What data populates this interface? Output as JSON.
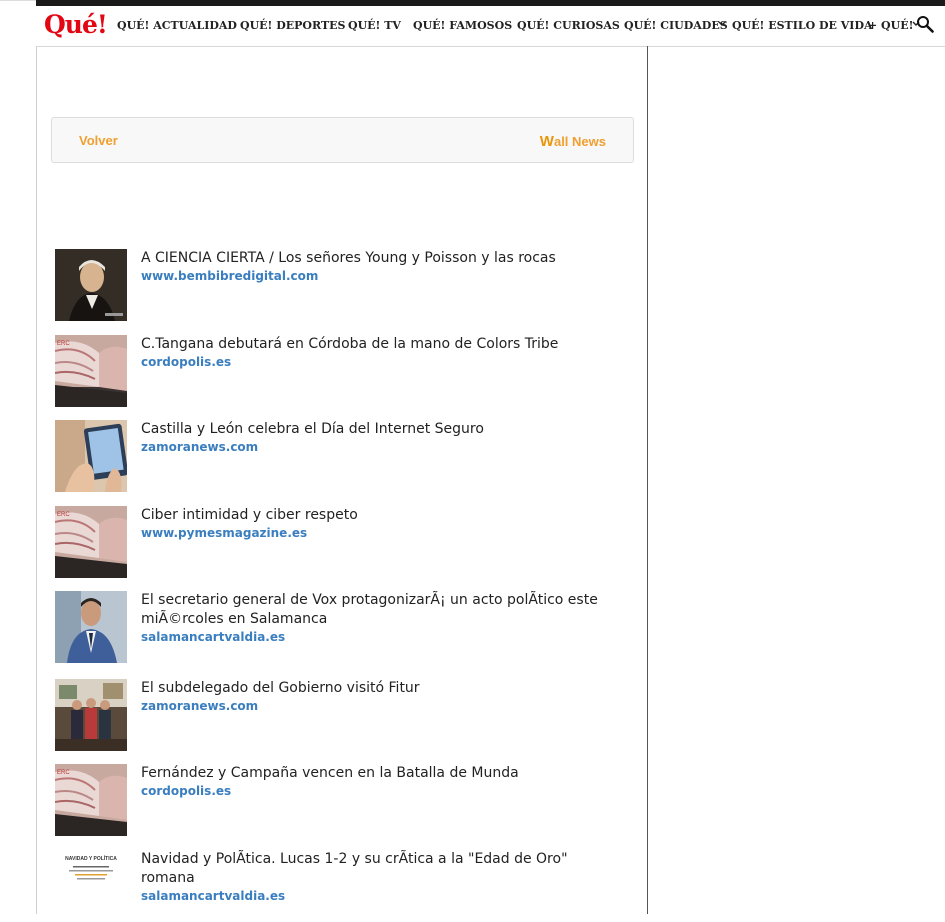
{
  "header": {
    "logo": "Qué!",
    "nav": [
      {
        "label": "QUÉ! ACTUALIDAD"
      },
      {
        "label": "QUÉ! DEPORTES"
      },
      {
        "label": "QUÉ! TV"
      },
      {
        "label": "QUÉ! FAMOSOS"
      },
      {
        "label": "QUÉ! CURIOSAS"
      },
      {
        "label": "QUÉ! CIUDADES"
      },
      {
        "label": "QUÉ! ESTILO DE VIDA"
      },
      {
        "label": "+ QUÉ!"
      }
    ]
  },
  "wall": {
    "back_label": "Volver",
    "brand_w": "W",
    "brand_rest": "all News"
  },
  "articles": [
    {
      "title": "A CIENCIA CIERTA / Los señores Young y Poisson y las rocas",
      "source": "www.bembibredigital.com",
      "thumb": "portrait"
    },
    {
      "title": "C.Tangana debutará en Córdoba de la mano de Colors Tribe",
      "source": "cordopolis.es",
      "thumb": "newspaper"
    },
    {
      "title": "Castilla y León celebra el Día del Internet Seguro",
      "source": "zamoranews.com",
      "thumb": "tablet"
    },
    {
      "title": "Ciber intimidad y ciber respeto",
      "source": "www.pymesmagazine.es",
      "thumb": "newspaper"
    },
    {
      "title": "El secretario general de Vox protagonizarÃ¡ un acto polÃtico este miÃ©rcoles en Salamanca",
      "source": "salamancartvaldia.es",
      "thumb": "man-suit"
    },
    {
      "title": "El subdelegado del Gobierno visitó Fitur",
      "source": "zamoranews.com",
      "thumb": "group"
    },
    {
      "title": "Fernández y Campaña vencen en la Batalla de Munda",
      "source": "cordopolis.es",
      "thumb": "newspaper"
    },
    {
      "title": "Navidad y PolÃtica. Lucas 1-2 y su crÃtica a la \"Edad de Oro\" romana",
      "source": "salamancartvaldia.es",
      "thumb": "book-cover",
      "thumb_text": "NAVIDAD Y POLÍTICA"
    }
  ]
}
